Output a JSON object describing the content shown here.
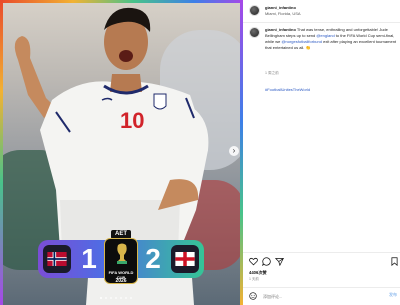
{
  "photo": {
    "jersey_number": "10",
    "scoreboard": {
      "badge": "AET",
      "home_score": "1",
      "away_score": "2",
      "logo_text": "FIFA WORLD CUP",
      "logo_year": "2026"
    }
  },
  "header": {
    "username": "gianni_infantino",
    "location": "Miami, Florida, USA"
  },
  "post": {
    "username": "gianni_infantino",
    "caption_parts": [
      " That was tense, enthralling and unforgettable! Jude Bellingham steps up to send ",
      "@england",
      " to the FIFA World Cup semi-final, while we ",
      "@norgesfotballforbund",
      " exit after playing an excellent tournament that entertained us all. "
    ],
    "meta": "1 周之前",
    "hashtag": "#FootballUnitesTheWorld"
  },
  "footer": {
    "likes": "4406次赞",
    "days": "1 天前",
    "comment_placeholder": "添加评论...",
    "post_button": "发布"
  },
  "colors": {
    "link": "#2b59c3",
    "accent": "#4e6de4"
  }
}
